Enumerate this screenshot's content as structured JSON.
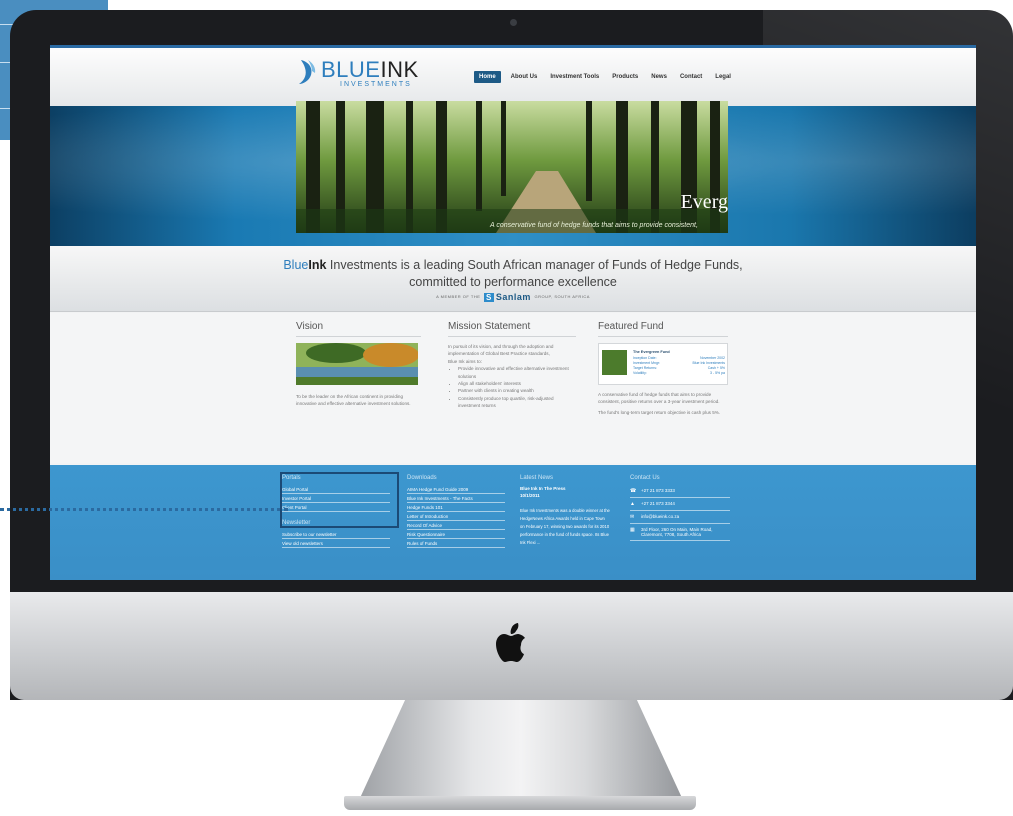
{
  "site": {
    "logo_main": "BLUE",
    "logo_ink": "INK",
    "logo_sub": "INVESTMENTS",
    "nav": [
      "Home",
      "About Us",
      "Investment Tools",
      "Products",
      "News",
      "Contact",
      "Legal"
    ],
    "nav_active_index": 0
  },
  "hero": {
    "title": "Everg",
    "caption": "A conservative fund of hedge funds that aims to provide consistent,"
  },
  "tagline": {
    "blue": "Blue",
    "ink": "Ink",
    "line1_rest": " Investments is a leading South African manager of Funds of Hedge Funds,",
    "line2": "committed to performance excellence",
    "member_prefix": "A MEMBER OF THE",
    "member_brand": "Sanlam",
    "member_suffix": "GROUP, SOUTH AFRICA"
  },
  "vision": {
    "heading": "Vision",
    "text": "To be the leader on the African continent in providing innovative and effective alternative investment solutions."
  },
  "mission": {
    "heading": "Mission Statement",
    "intro": "In pursuit of its vision, and through the adoption and implementation of Global Best Practice standards,",
    "aim": "Blue Ink aims to:",
    "bullets": [
      "Provide innovative and effective alternative investment solutions",
      "Align all stakeholders' interests",
      "Partner with clients in creating wealth",
      "Consistently produce top quartile, risk-adjusted investment returns"
    ]
  },
  "featured": {
    "heading": "Featured Fund",
    "fund_name": "The Evergreen Fund",
    "rows": [
      [
        "Inception Date:",
        "November 2002"
      ],
      [
        "Investment Mngr:",
        "Blue Ink Investments"
      ],
      [
        "Target Returns:",
        "Cash + 5%"
      ],
      [
        "Volatility:",
        "3 - 5% pa"
      ]
    ],
    "p1": "A conservative fund of hedge funds that aims to provide consistent, positive returns over a 3-year investment period.",
    "p2": "The fund's long-term target return objective is cash plus 5%."
  },
  "footer": {
    "portals": {
      "heading": "Portals",
      "links": [
        "Global Portal",
        "Investor Portal",
        "Client Portal"
      ]
    },
    "newsletter": {
      "heading": "Newsletter",
      "links": [
        "Subscribe to our newsletter",
        "View old newsletters"
      ]
    },
    "downloads": {
      "heading": "Downloads",
      "links": [
        "AIMA Hedge Fund Guide 2009",
        "Blue Ink Investments - The Facts",
        "Hedge Funds 101",
        "Letter of Introduction",
        "Record Of Advice",
        "Risk Questionnaire",
        "Rules of Funds"
      ]
    },
    "news": {
      "heading": "Latest News",
      "title": "Blue Ink In The Press",
      "date": "10/1/2011",
      "body": "Blue Ink Investments was a double winner at the HedgeNews Africa Awards held in Cape Town on February 17, winning two awards for its 2010 performance in the fund of funds space. Its Blue Ink Flexi ..."
    },
    "contact": {
      "heading": "Contact Us",
      "phone": "+27 21 873 3333",
      "fax": "+27 21 873 3344",
      "email": "info@blueink.co.za",
      "address": "3rd Floor, 260 On Main, Main Road, Claremont, 7708, South Africa"
    }
  }
}
